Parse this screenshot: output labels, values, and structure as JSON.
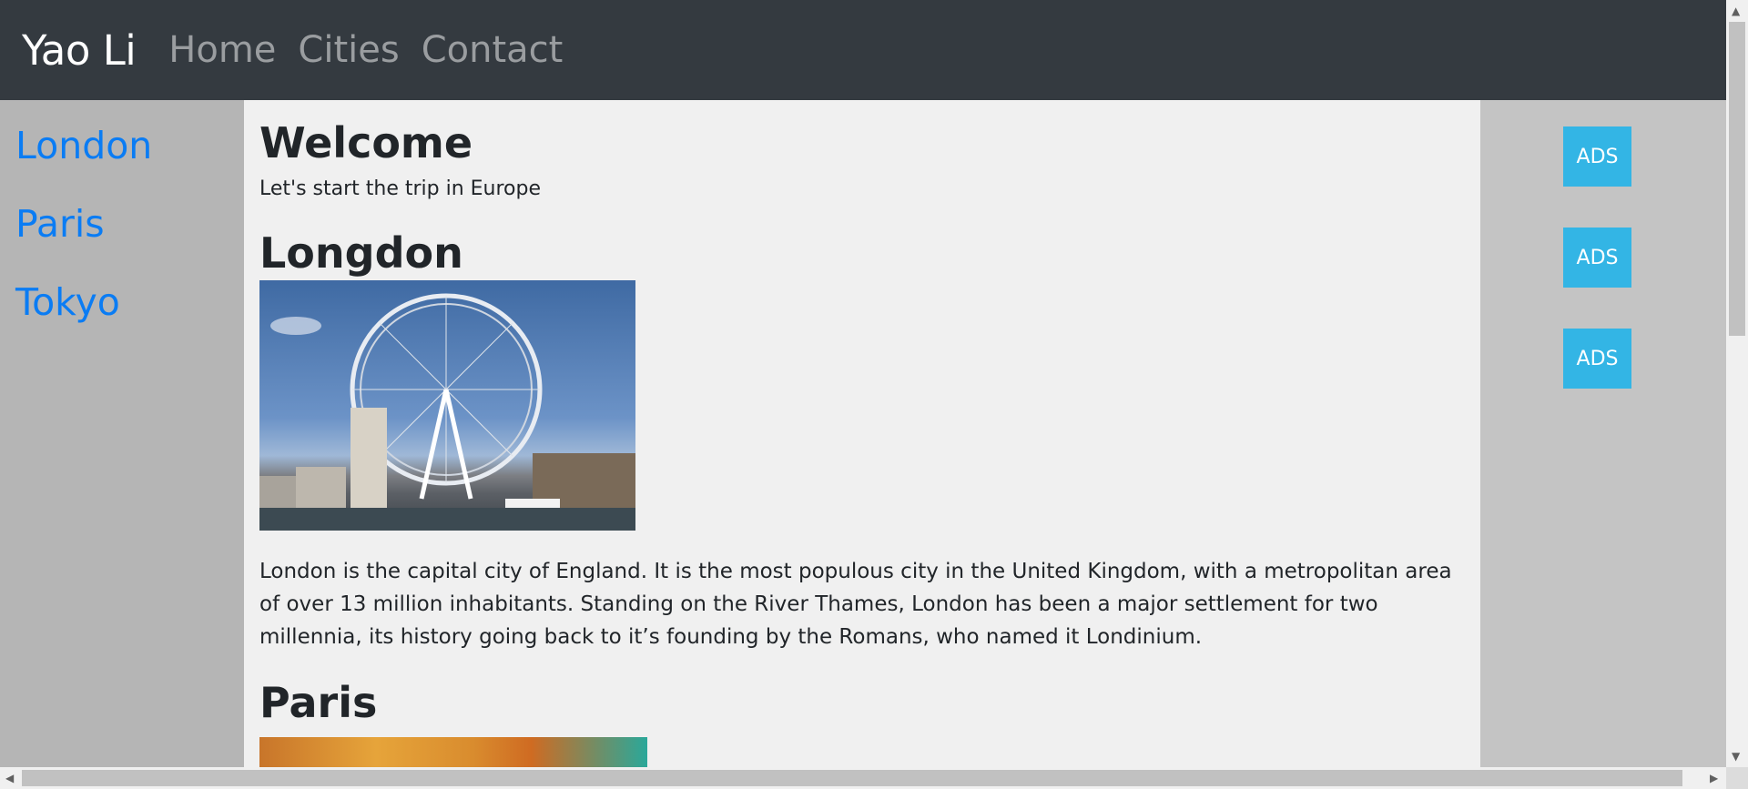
{
  "navbar": {
    "brand": "Yao Li",
    "links": [
      "Home",
      "Cities",
      "Contact"
    ]
  },
  "sidebar": {
    "links": [
      "London",
      "Paris",
      "Tokyo"
    ]
  },
  "main": {
    "title": "Welcome",
    "subtitle": "Let's start the trip in Europe",
    "sections": [
      {
        "heading": "Longdon",
        "text": "London is the capital city of England. It is the most populous city in the United Kingdom, with a metropolitan area of over 13 million inhabitants. Standing on the River Thames, London has been a major settlement for two millennia, its history going back to it’s founding by the Romans, who named it Londinium."
      },
      {
        "heading": "Paris"
      }
    ]
  },
  "ads": [
    "ADS",
    "ADS",
    "ADS"
  ],
  "colors": {
    "navbar": "#343a40",
    "link": "#0a7cf4",
    "ad": "#33b5e5",
    "sidebar": "#b5b5b5",
    "ads_column": "#c4c4c4"
  }
}
